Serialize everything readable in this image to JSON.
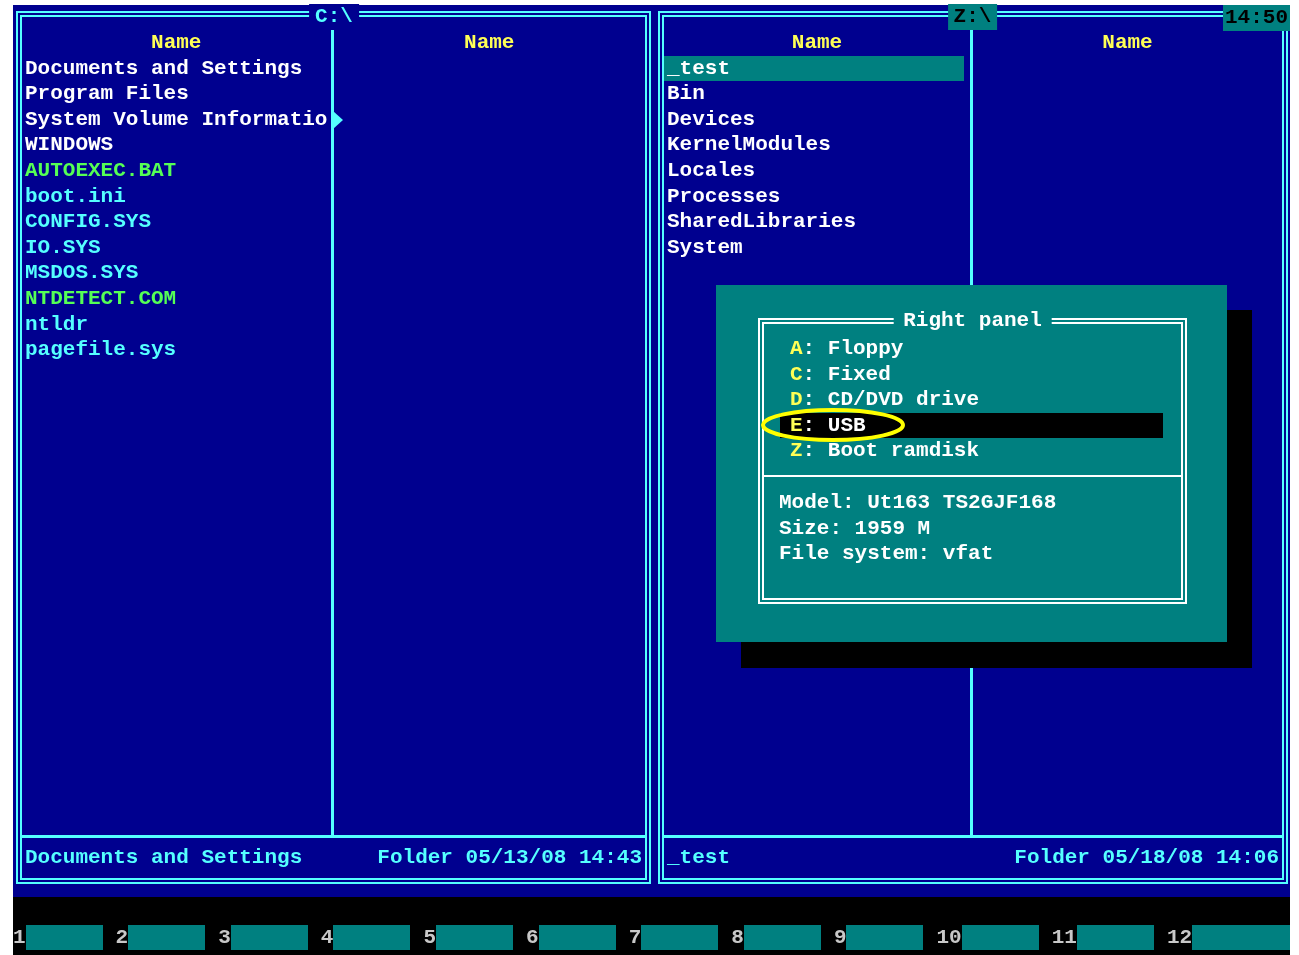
{
  "panels": [
    {
      "title": "C:\\",
      "active": false,
      "columns": [
        {
          "header": "Name",
          "files": [
            {
              "name": "Documents and Settings",
              "kind": "folder",
              "selected": false,
              "truncated": false
            },
            {
              "name": "Program Files",
              "kind": "folder",
              "selected": false,
              "truncated": false
            },
            {
              "name": "System Volume Informatio",
              "kind": "folder",
              "selected": false,
              "truncated": true
            },
            {
              "name": "WINDOWS",
              "kind": "folder",
              "selected": false,
              "truncated": false
            },
            {
              "name": "AUTOEXEC.BAT",
              "kind": "executable",
              "selected": false,
              "truncated": false
            },
            {
              "name": "boot.ini",
              "kind": "file",
              "selected": false,
              "truncated": false
            },
            {
              "name": "CONFIG.SYS",
              "kind": "file",
              "selected": false,
              "truncated": false
            },
            {
              "name": "IO.SYS",
              "kind": "file",
              "selected": false,
              "truncated": false
            },
            {
              "name": "MSDOS.SYS",
              "kind": "file",
              "selected": false,
              "truncated": false
            },
            {
              "name": "NTDETECT.COM",
              "kind": "executable",
              "selected": false,
              "truncated": false
            },
            {
              "name": "ntldr",
              "kind": "file",
              "selected": false,
              "truncated": false
            },
            {
              "name": "pagefile.sys",
              "kind": "file",
              "selected": false,
              "truncated": false
            }
          ]
        },
        {
          "header": "Name"
        }
      ],
      "status": {
        "name": "Documents and Settings",
        "info": "Folder 05/13/08 14:43"
      }
    },
    {
      "title": "Z:\\",
      "active": true,
      "columns": [
        {
          "header": "Name",
          "files": [
            {
              "name": "_test",
              "kind": "folder",
              "selected": true,
              "truncated": false
            },
            {
              "name": "Bin",
              "kind": "folder",
              "selected": false,
              "truncated": false
            },
            {
              "name": "Devices",
              "kind": "folder",
              "selected": false,
              "truncated": false
            },
            {
              "name": "KernelModules",
              "kind": "folder",
              "selected": false,
              "truncated": false
            },
            {
              "name": "Locales",
              "kind": "folder",
              "selected": false,
              "truncated": false
            },
            {
              "name": "Processes",
              "kind": "folder",
              "selected": false,
              "truncated": false
            },
            {
              "name": "SharedLibraries",
              "kind": "folder",
              "selected": false,
              "truncated": false
            },
            {
              "name": "System",
              "kind": "folder",
              "selected": false,
              "truncated": false
            }
          ]
        },
        {
          "header": "Name"
        }
      ],
      "status": {
        "name": "_test",
        "info": "Folder 05/18/08 14:06"
      }
    }
  ],
  "clock": "14:50",
  "dialog": {
    "title": "Right panel",
    "drives": [
      {
        "letter": "A",
        "label": ": Floppy",
        "selected": false
      },
      {
        "letter": "C",
        "label": ": Fixed",
        "selected": false
      },
      {
        "letter": "D",
        "label": ": CD/DVD drive",
        "selected": false
      },
      {
        "letter": "E",
        "label": ": USB",
        "selected": true
      },
      {
        "letter": "Z",
        "label": ": Boot ramdisk",
        "selected": false
      }
    ],
    "info": [
      "Model: Ut163 TS2GJF168",
      "Size: 1959 M",
      "File system: vfat"
    ]
  },
  "function_keys": [
    "1",
    "2",
    "3",
    "4",
    "5",
    "6",
    "7",
    "8",
    "9",
    "10",
    "11",
    "12"
  ]
}
